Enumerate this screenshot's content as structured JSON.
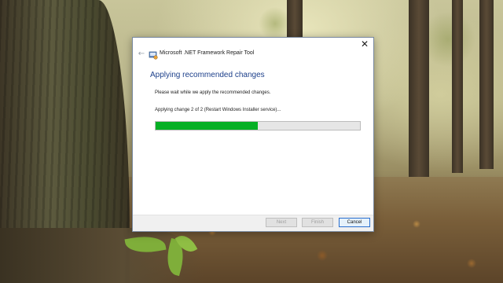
{
  "window": {
    "title": "Microsoft .NET Framework Repair Tool",
    "close_glyph": "✕",
    "back_glyph": "←"
  },
  "page": {
    "heading": "Applying recommended changes",
    "description": "Please wait while we apply the recommended changes.",
    "status": "Applying change 2 of 2 (Restart Windows Installer service)...",
    "progress_fraction": 0.5
  },
  "buttons": {
    "next": "Next",
    "finish": "Finish",
    "cancel": "Cancel"
  },
  "colors": {
    "heading": "#1c3f8a",
    "progress_fill": "#06b025",
    "progress_track": "#e6e6e6"
  },
  "icons": {
    "app": "dotnet-repair-tool-icon",
    "back": "back-arrow-icon",
    "close": "close-icon"
  }
}
